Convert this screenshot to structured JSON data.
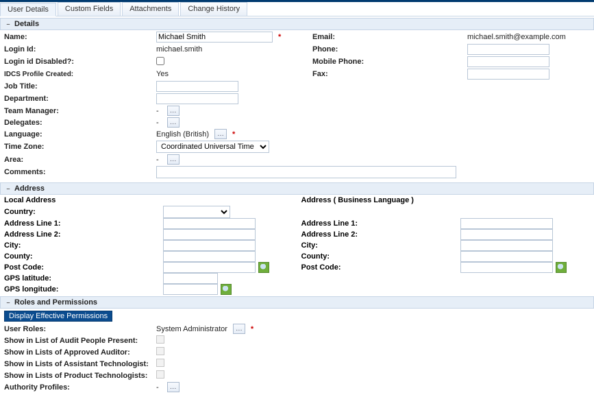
{
  "tabs": [
    "User Details",
    "Custom Fields",
    "Attachments",
    "Change History"
  ],
  "sections": {
    "details": {
      "title": "Details"
    },
    "address": {
      "title": "Address"
    },
    "roles": {
      "title": "Roles and Permissions"
    }
  },
  "details": {
    "labels": {
      "name": "Name:",
      "email": "Email:",
      "login_id": "Login Id:",
      "phone": "Phone:",
      "login_disabled": "Login id Disabled?:",
      "mobile": "Mobile Phone:",
      "idcs": "IDCS Profile Created:",
      "fax": "Fax:",
      "job_title": "Job Title:",
      "department": "Department:",
      "team_manager": "Team Manager:",
      "delegates": "Delegates:",
      "language": "Language:",
      "time_zone": "Time Zone:",
      "area": "Area:",
      "comments": "Comments:"
    },
    "values": {
      "name": "Michael Smith",
      "email": "michael.smith@example.com",
      "login_id": "michael.smith",
      "idcs": "Yes",
      "language": "English (British)",
      "time_zone": "Coordinated Universal Time (UTC)"
    }
  },
  "address": {
    "local_header": "Local Address",
    "business_header": "Address ( Business Language )",
    "labels": {
      "country": "Country:",
      "addr1": "Address Line 1:",
      "addr2": "Address Line 2:",
      "city": "City:",
      "county": "County:",
      "postcode": "Post Code:",
      "gps_lat": "GPS latitude:",
      "gps_lon": "GPS longitude:"
    }
  },
  "roles": {
    "effective_btn": "Display Effective Permissions",
    "labels": {
      "user_roles": "User Roles:",
      "audit_present": "Show in List of Audit People Present:",
      "approved_auditor": "Show in Lists of Approved Auditor:",
      "assistant_tech": "Show in Lists of Assistant Technologist:",
      "product_tech": "Show in Lists of Product Technologists:",
      "authority_profiles": "Authority Profiles:"
    },
    "values": {
      "user_roles": "System Administrator"
    }
  }
}
